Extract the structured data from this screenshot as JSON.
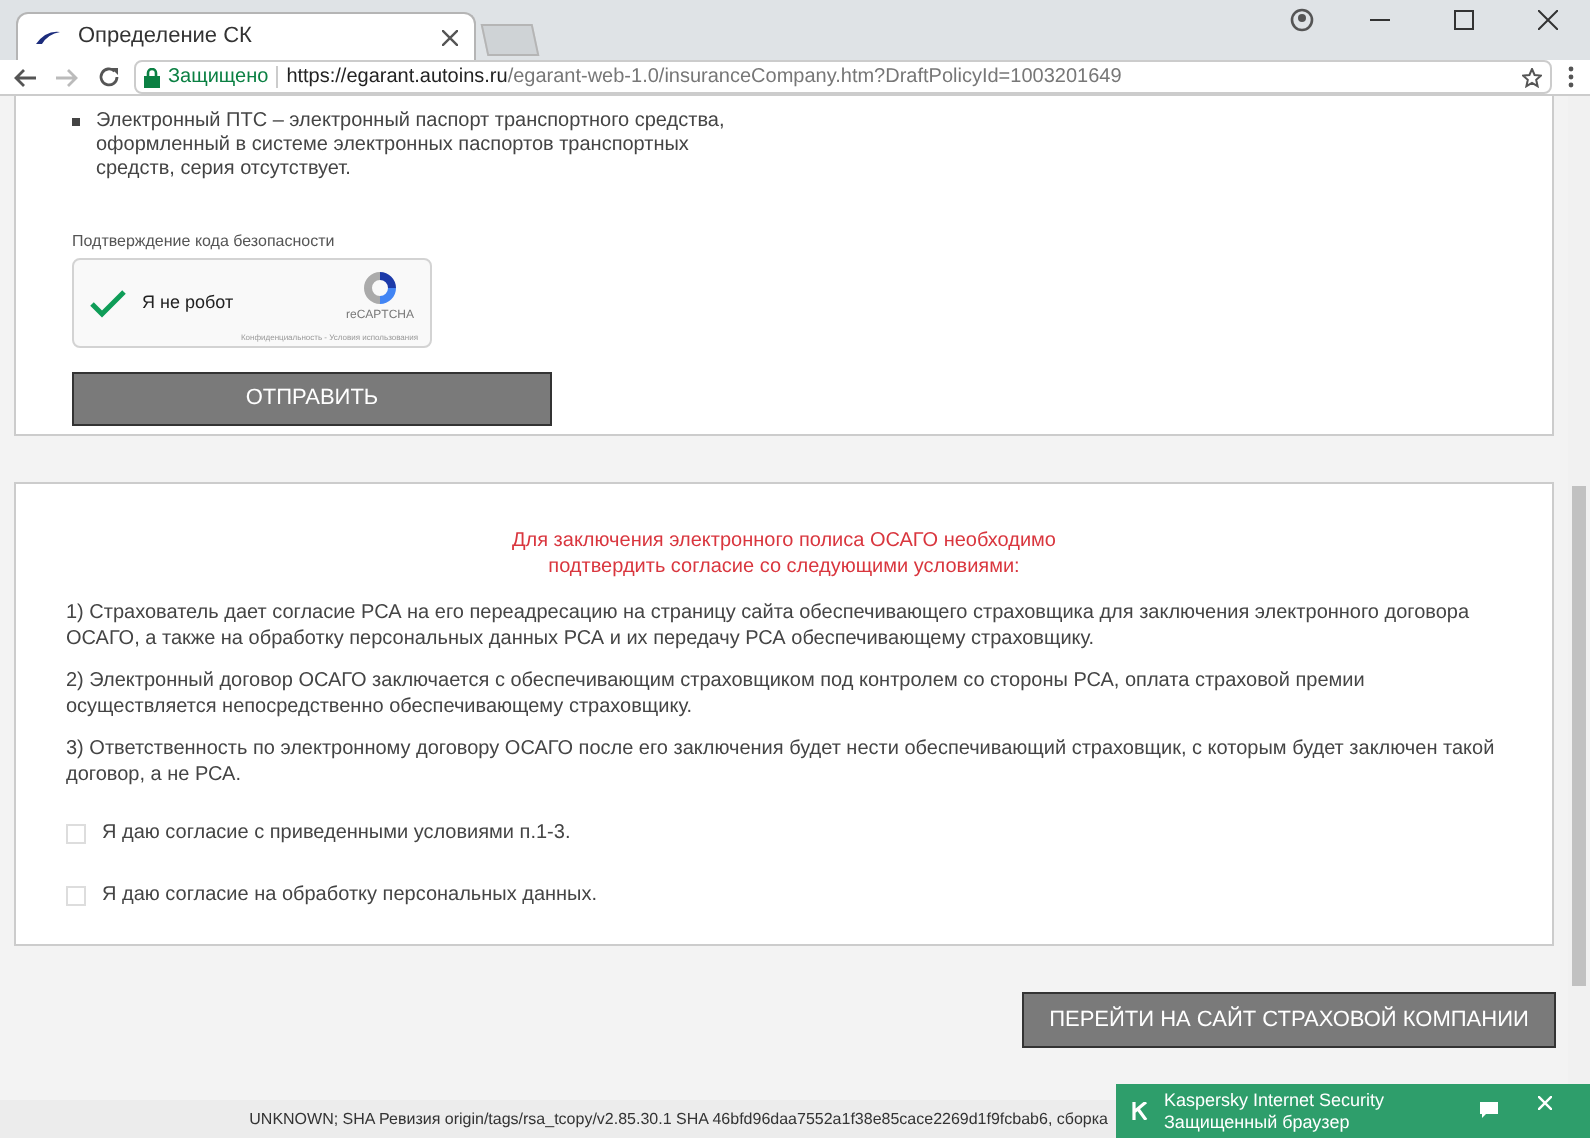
{
  "browser": {
    "tab_title": "Определение СК",
    "secure_label": "Защищено",
    "url_host": "https://egarant.autoins.ru",
    "url_path": "/egarant-web-1.0/insuranceCompany.htm?DraftPolicyId=1003201649"
  },
  "top_card": {
    "bullets": [
      "Электронный ПТС – электронный паспорт транспортного средства, оформленный в системе электронных паспортов транспортных средств, серия отсутствует."
    ],
    "captcha_label": "Подтверждение кода безопасности",
    "captcha": {
      "checked": true,
      "label": "Я не робот",
      "brand": "reCAPTCHA",
      "links": "Конфиденциальность - Условия использования"
    },
    "submit": "ОТПРАВИТЬ"
  },
  "consent_card": {
    "heading": [
      "Для заключения электронного полиса ОСАГО необходимо",
      "подтвердить согласие со следующими условиями:"
    ],
    "terms": [
      "1) Страхователь дает согласие РСА на его переадресацию на страницу сайта обеспечивающего страховщика для заключения электронного договора ОСАГО, а также на обработку персональных данных РСА и их передачу РСА обеспечивающему страховщику.",
      "2) Электронный договор ОСАГО заключается с обеспечивающим страховщиком под контролем со стороны РСА, оплата страховой премии осуществляется непосредственно обеспечивающему страховщику.",
      "3) Ответственность по электронному договору ОСАГО после его заключения будет нести обеспечивающий страховщик, с которым будет заключен такой договор, а не РСА."
    ],
    "checkboxes": [
      {
        "label": "Я даю согласие с приведенными условиями п.1-3.",
        "checked": false
      },
      {
        "label": "Я даю согласие на обработку персональных данных.",
        "checked": false
      }
    ]
  },
  "go_button": "ПЕРЕЙТИ НА САЙТ СТРАХОВОЙ КОМПАНИИ",
  "footer": "UNKNOWN; SHA Ревизия origin/tags/rsa_tcopy/v2.85.30.1 SHA 46bfd96daa7552a1f38e85cace2269d1f9fcbab6, сборка",
  "notification": {
    "text": "Kaspersky Internet Security Защищенный браузер"
  }
}
